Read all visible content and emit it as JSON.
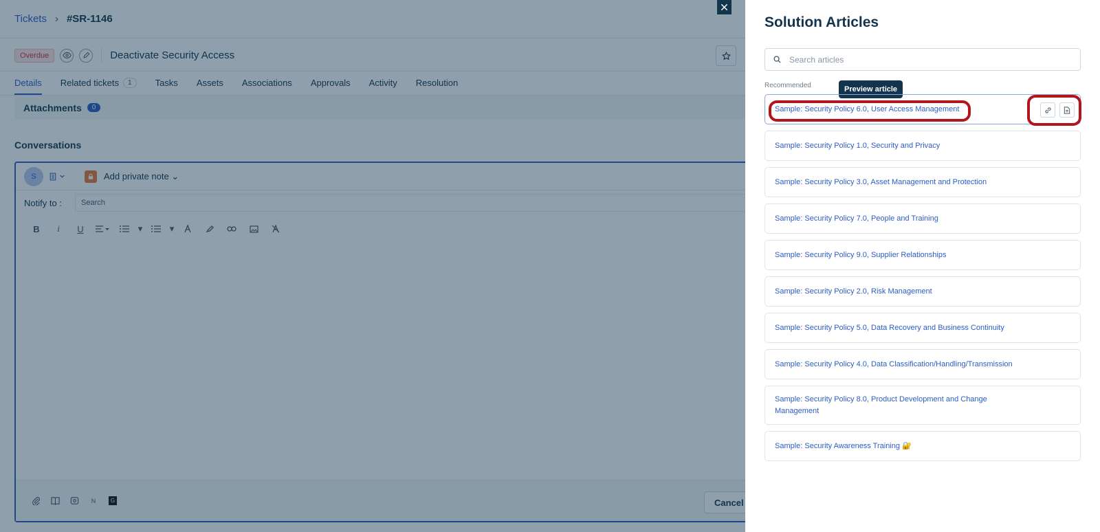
{
  "breadcrumb": {
    "tickets": "Tickets",
    "ticket_id": "#SR-1146"
  },
  "ticket": {
    "status_badge": "Overdue",
    "title": "Deactivate Security Access"
  },
  "tabs": [
    {
      "label": "Details",
      "active": true
    },
    {
      "label": "Related tickets",
      "count": "1"
    },
    {
      "label": "Tasks"
    },
    {
      "label": "Assets"
    },
    {
      "label": "Associations"
    },
    {
      "label": "Approvals"
    },
    {
      "label": "Activity"
    },
    {
      "label": "Resolution"
    }
  ],
  "attachments": {
    "label": "Attachments",
    "count": "0"
  },
  "conversations": {
    "title": "Conversations",
    "avatar_initial": "S",
    "note_type": "Add private note",
    "notify_label": "Notify to :",
    "notify_placeholder": "Search",
    "cancel_label": "Cancel",
    "footer_badge_n": "N",
    "footer_badge_g": "G"
  },
  "panel": {
    "title": "Solution Articles",
    "search_placeholder": "Search articles",
    "recommended_label": "Recommended",
    "tooltip": "Preview article",
    "articles": [
      "Sample: Security Policy 6.0, User Access Management",
      "Sample: Security Policy 1.0, Security and Privacy",
      "Sample: Security Policy 3.0, Asset Management and Protection",
      "Sample: Security Policy 7.0, People and Training",
      "Sample: Security Policy 9.0, Supplier Relationships",
      "Sample: Security Policy 2.0, Risk Management",
      "Sample: Security Policy 5.0, Data Recovery and Business Continuity",
      "Sample: Security Policy 4.0, Data Classification/Handling/Transmission",
      "Sample: Security Policy 8.0, Product Development and Change Management",
      "Sample: Security Awareness Training 🔐"
    ]
  },
  "colors": {
    "accent": "#2c5cc5",
    "highlight_ring": "#b3151c",
    "overlay": "#12344d"
  }
}
